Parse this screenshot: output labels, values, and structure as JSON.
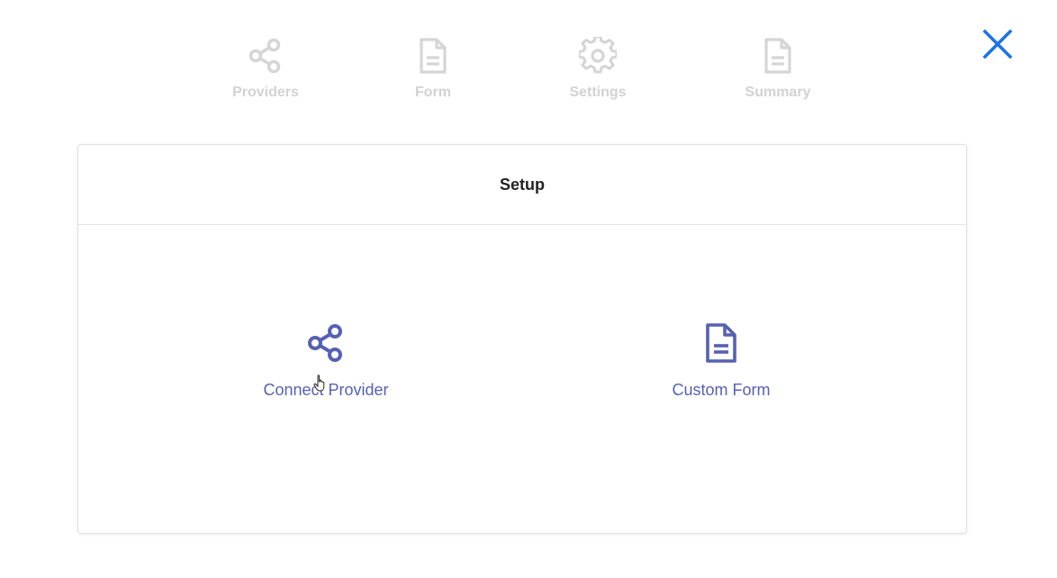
{
  "steps": [
    {
      "label": "Providers",
      "icon": "share-icon"
    },
    {
      "label": "Form",
      "icon": "document-icon"
    },
    {
      "label": "Settings",
      "icon": "gear-icon"
    },
    {
      "label": "Summary",
      "icon": "document-icon"
    }
  ],
  "close": {
    "icon": "close-icon"
  },
  "card": {
    "title": "Setup",
    "options": [
      {
        "label": "Connect Provider",
        "icon": "share-icon"
      },
      {
        "label": "Custom Form",
        "icon": "document-icon"
      }
    ]
  },
  "colors": {
    "accent": "#5661b3",
    "close": "#1a73e8",
    "inactive": "#d5d5d5"
  }
}
